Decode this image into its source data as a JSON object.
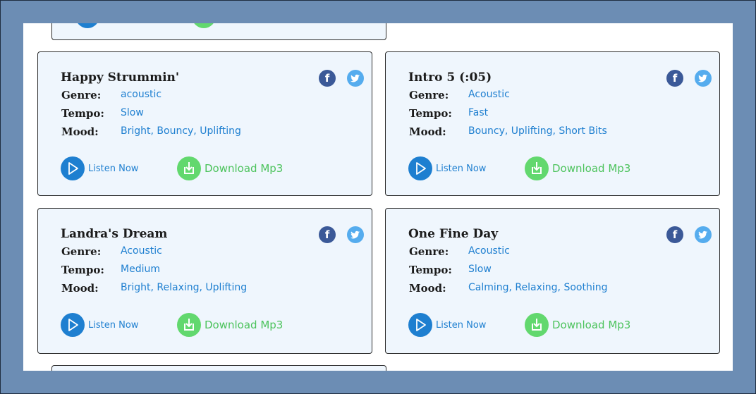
{
  "labels": {
    "genre": "Genre:",
    "tempo": "Tempo:",
    "mood": "Mood:"
  },
  "actions": {
    "listen": "Listen Now",
    "download": "Download Mp3"
  },
  "colors": {
    "accent_blue": "#1e7fd0",
    "download_green": "#62d86e",
    "facebook": "#3b5998",
    "twitter": "#55acee",
    "page_bg": "#6c8db4",
    "card_bg": "#eff6fd"
  },
  "icons": {
    "facebook": "facebook-icon",
    "twitter": "twitter-icon",
    "play": "play-icon",
    "download": "download-icon"
  },
  "tracks": [
    {
      "title": "Happy Strummin'",
      "genre": "acoustic",
      "tempo": "Slow",
      "mood": "Bright, Bouncy, Uplifting"
    },
    {
      "title": "Intro 5 (:05)",
      "genre": "Acoustic",
      "tempo": "Fast",
      "mood": "Bouncy, Uplifting, Short Bits"
    },
    {
      "title": "Landra's Dream",
      "genre": "Acoustic",
      "tempo": "Medium",
      "mood": "Bright, Relaxing, Uplifting"
    },
    {
      "title": "One Fine Day",
      "genre": "Acoustic",
      "tempo": "Slow",
      "mood": "Calming, Relaxing, Soothing"
    }
  ]
}
